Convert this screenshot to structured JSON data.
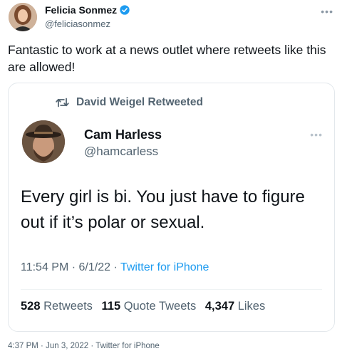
{
  "outer": {
    "display_name": "Felicia Sonmez",
    "handle": "@feliciasonmez",
    "verified": true,
    "text": "Fantastic to work at a news outlet where retweets like this are allowed!",
    "more_icon": "more-horizontal-icon",
    "footer": {
      "time": "4:37 PM",
      "date": "Jun 3, 2022",
      "source": "Twitter for iPhone",
      "separator": "·"
    }
  },
  "quoted": {
    "retweeted_by": "David Weigel Retweeted",
    "retweet_icon": "retweet-icon",
    "display_name": "Cam Harless",
    "handle": "@hamcarless",
    "text": "Every girl is bi. You just have to figure out if it’s polar or sexual.",
    "time": "11:54 PM",
    "date": "6/1/22",
    "source": "Twitter for iPhone",
    "separator": "·",
    "stats": {
      "retweets_count": "528",
      "retweets_label": "Retweets",
      "quotes_count": "115",
      "quotes_label": "Quote Tweets",
      "likes_count": "4,347",
      "likes_label": "Likes"
    }
  },
  "colors": {
    "text_primary": "#0f1419",
    "text_secondary": "#536471",
    "link": "#1d9bf0",
    "verified": "#1d9bf0",
    "border": "#e3e8ec"
  }
}
